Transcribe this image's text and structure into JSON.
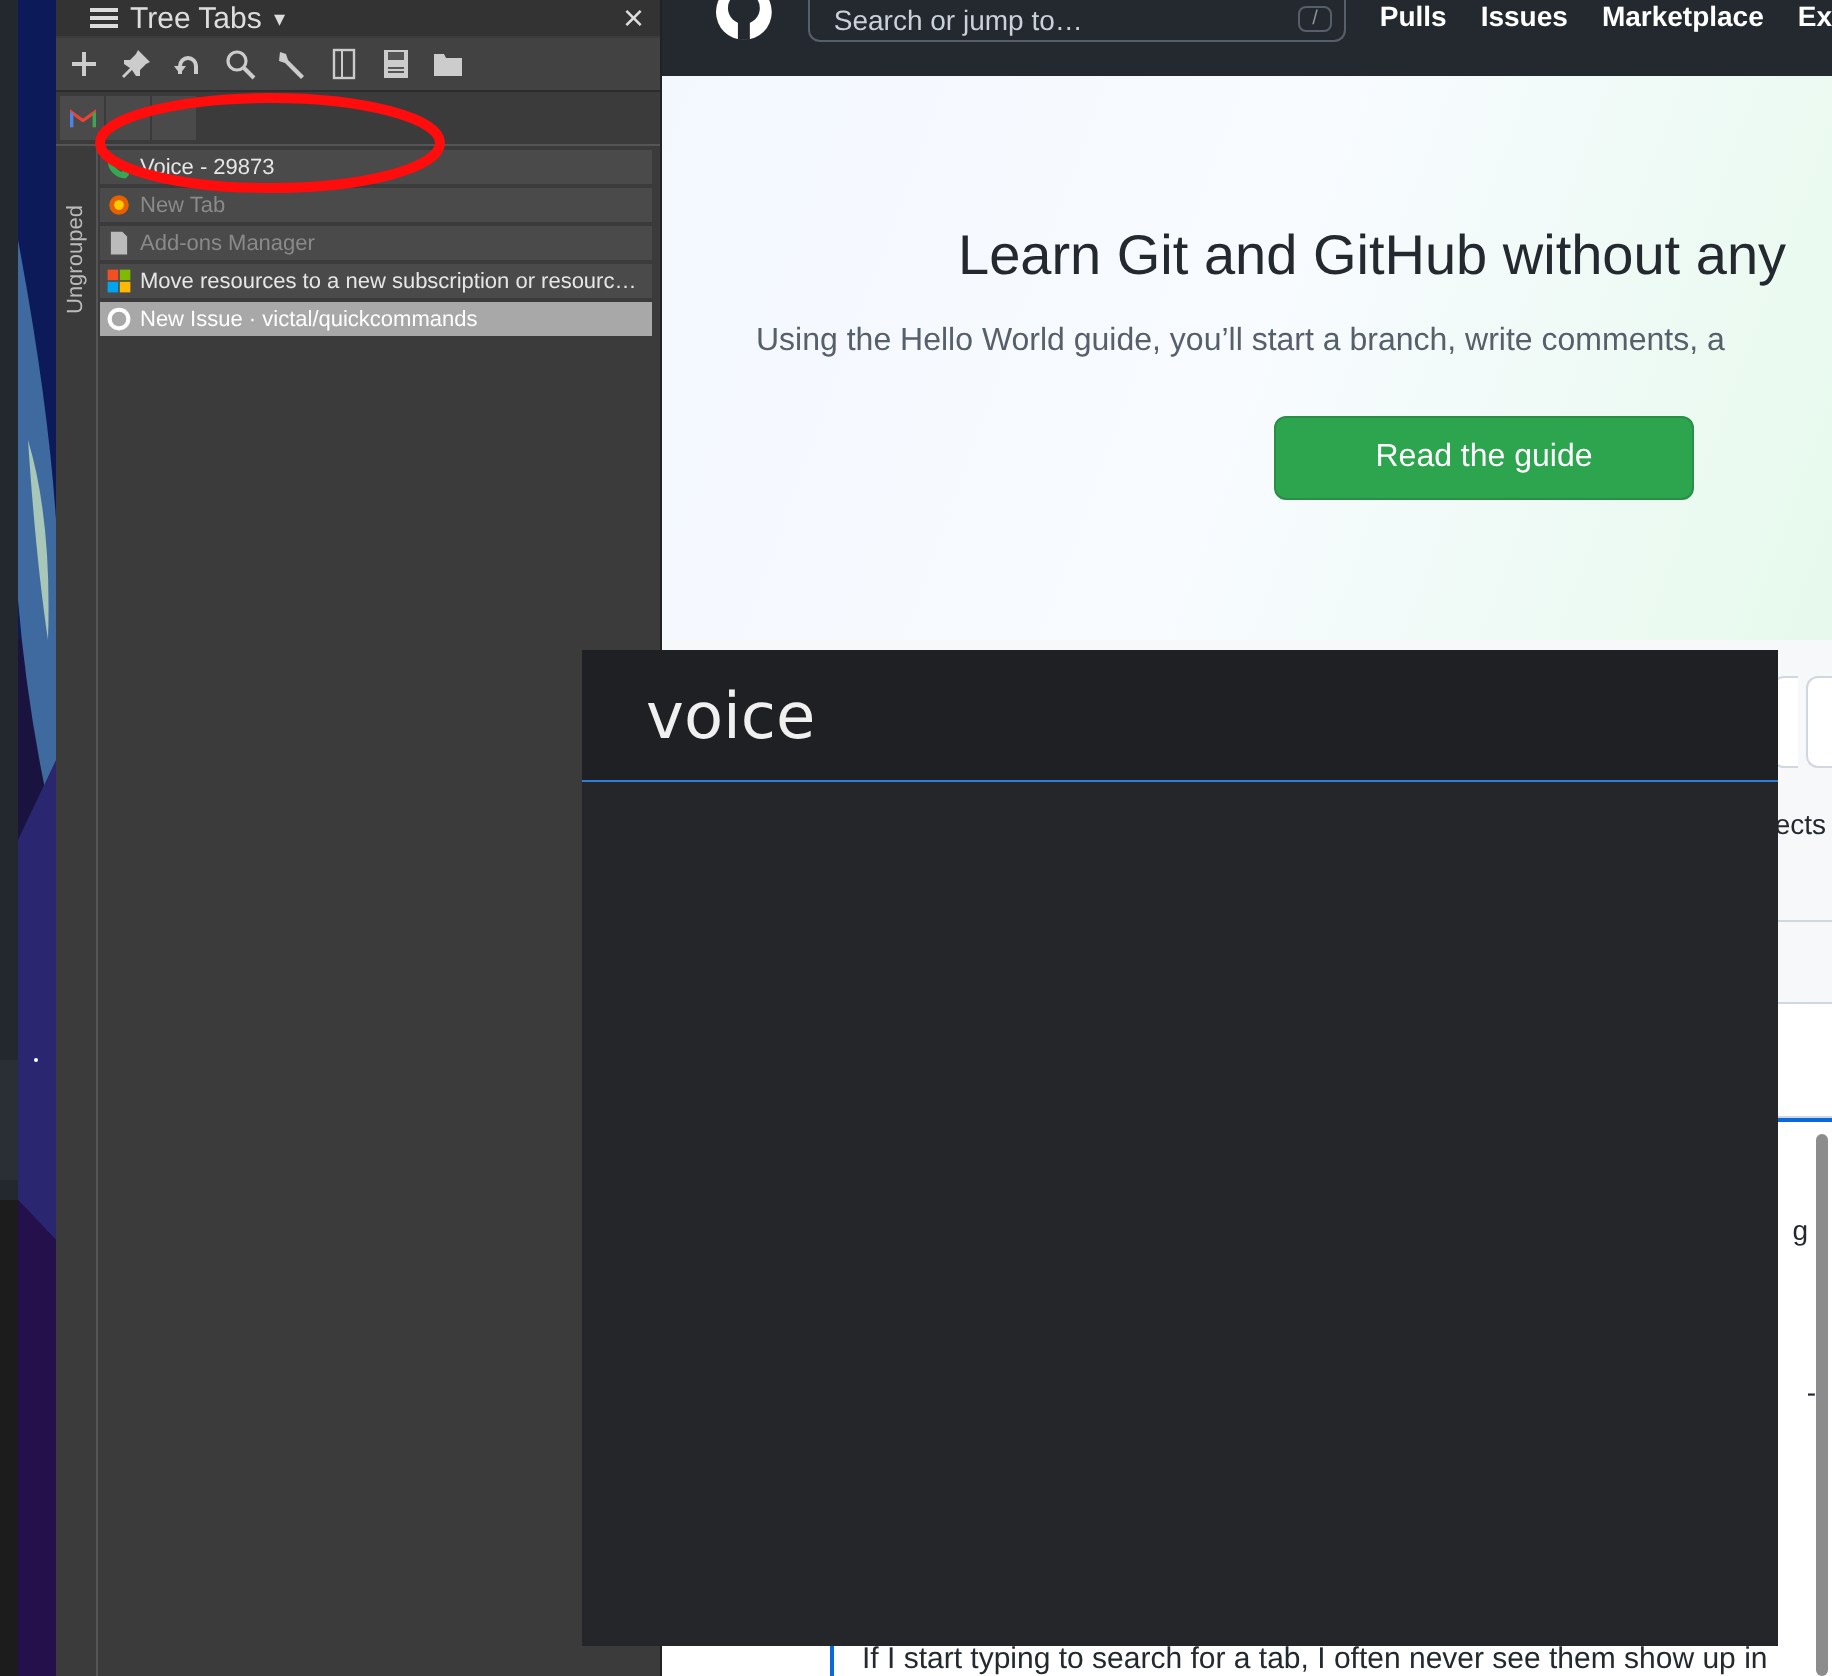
{
  "sidebar": {
    "title": "Tree Tabs",
    "menu_caret": "▾",
    "close": "×",
    "group_label": "Ungrouped",
    "tabs": [
      {
        "title": "Voice - 29873",
        "selected": false,
        "discarded": false
      },
      {
        "title": "New Tab",
        "selected": false,
        "discarded": true
      },
      {
        "title": "Add-ons Manager",
        "selected": false,
        "discarded": true
      },
      {
        "title": "Move resources to a new subscription or resourc…",
        "selected": false,
        "discarded": false
      },
      {
        "title": "New Issue · victal/quickcommands",
        "selected": true,
        "discarded": false
      }
    ]
  },
  "page": {
    "search": {
      "placeholder": "Search or jump to…",
      "shortcut": "/"
    },
    "nav": [
      "Pulls",
      "Issues",
      "Marketplace",
      "Ex"
    ],
    "hero": {
      "heading": "Learn Git and GitHub without any",
      "text": "Using the Hello World guide, you’ll start a branch, write comments, a",
      "button": "Read the guide"
    },
    "fragments": [
      "ects",
      "g",
      "-"
    ],
    "comment": "If I start typing to search for a tab, I often never see them show up in"
  },
  "popup": {
    "title": "voice"
  }
}
